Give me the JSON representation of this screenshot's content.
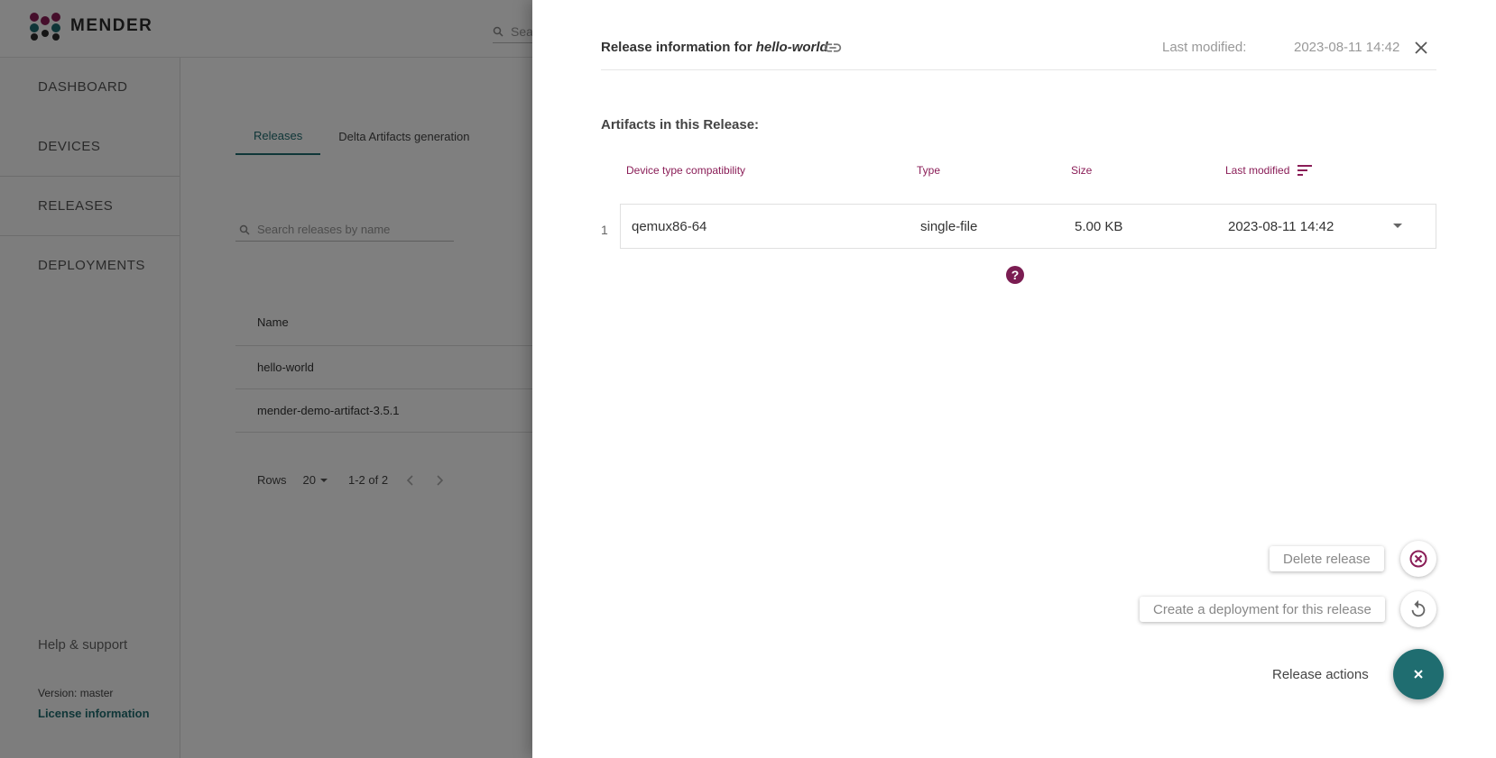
{
  "app": {
    "brand": "MENDER",
    "top_search_placeholder": "Search devices"
  },
  "sidebar": {
    "items": [
      {
        "label": "DASHBOARD"
      },
      {
        "label": "DEVICES"
      },
      {
        "label": "RELEASES"
      },
      {
        "label": "DEPLOYMENTS"
      }
    ],
    "help": "Help & support",
    "version": "Version: master",
    "license": "License information"
  },
  "releases_page": {
    "tabs": [
      {
        "label": "Releases",
        "active": true
      },
      {
        "label": "Delta Artifacts generation",
        "active": false
      }
    ],
    "search_placeholder": "Search releases by name",
    "table_header": "Name",
    "rows": [
      "hello-world",
      "mender-demo-artifact-3.5.1"
    ],
    "pager": {
      "rows_label": "Rows",
      "rows_value": "20",
      "range": "1-2 of 2"
    }
  },
  "drawer": {
    "title_prefix": "Release information for",
    "release_name": "hello-world",
    "last_modified_label": "Last modified:",
    "last_modified_value": "2023-08-11 14:42",
    "artifacts_title": "Artifacts in this Release:",
    "columns": [
      "Device type compatibility",
      "Type",
      "Size",
      "Last modified"
    ],
    "artifacts": [
      {
        "index": "1",
        "device_type": "qemux86-64",
        "type": "single-file",
        "size": "5.00 KB",
        "modified": "2023-08-11 14:42"
      }
    ],
    "actions": {
      "delete": "Delete release",
      "deploy": "Create a deployment for this release",
      "menu_label": "Release actions"
    }
  },
  "colors": {
    "accent_teal": "#1f6d70",
    "accent_plum": "#8a1d57",
    "overlay": "rgba(0,0,0,0.5)"
  },
  "icons": [
    "mender-logo-icon",
    "search-icon",
    "link-icon",
    "close-icon",
    "sort-icon",
    "chevron-down-icon",
    "help-icon",
    "delete-circle-icon",
    "replay-icon",
    "fab-close-icon",
    "chevron-left-icon",
    "chevron-right-icon"
  ]
}
